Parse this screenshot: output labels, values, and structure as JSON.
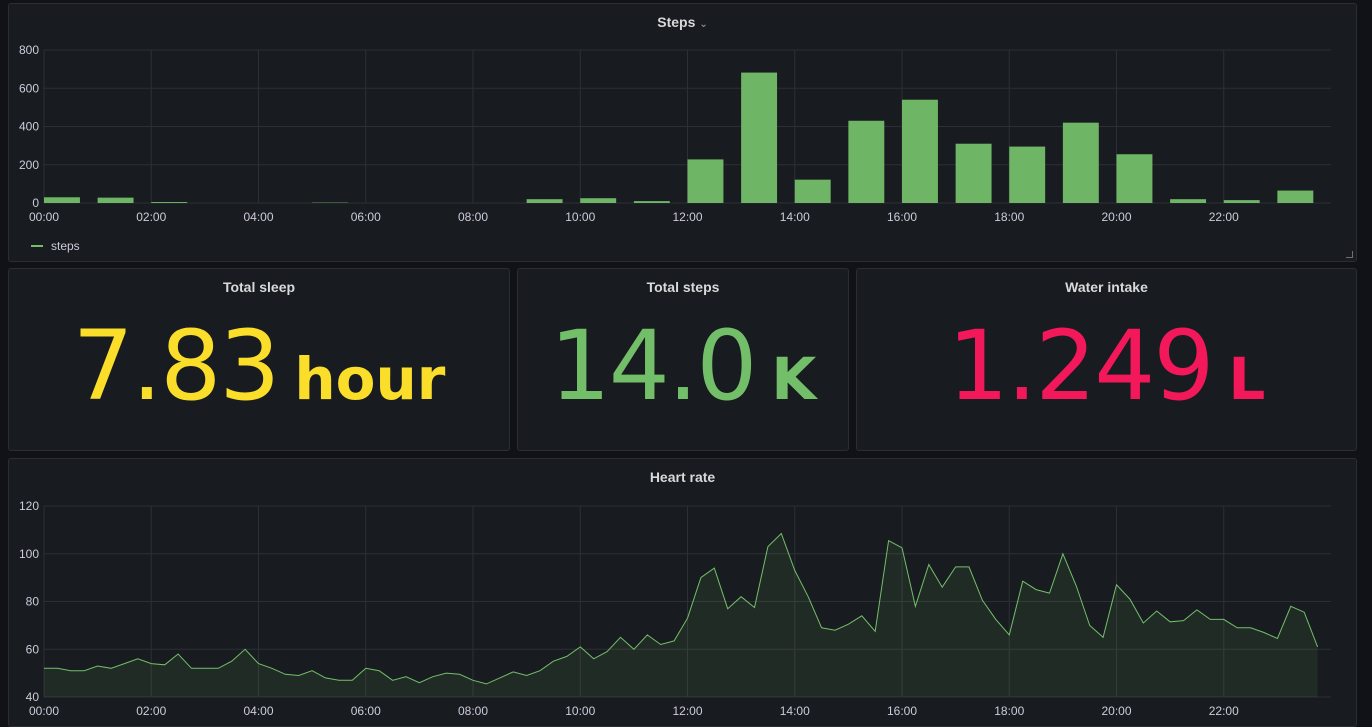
{
  "colors": {
    "background": "#111217",
    "panel": "#181b1f",
    "grid": "#2c2f35",
    "steps": "#73bf69",
    "sleep": "#fade2a",
    "water": "#f2185a"
  },
  "panels": {
    "steps": {
      "title": "Steps",
      "menu_icon": "chevron-down-icon",
      "legend": "steps"
    },
    "sleep": {
      "title": "Total sleep",
      "value": "7.83",
      "unit": "hour"
    },
    "total_steps": {
      "title": "Total steps",
      "value": "14.0",
      "unit": "K"
    },
    "water": {
      "title": "Water intake",
      "value": "1.249",
      "unit": "L"
    },
    "heart": {
      "title": "Heart rate"
    }
  },
  "chart_data": [
    {
      "type": "bar",
      "title": "Steps",
      "x_ticks": [
        "00:00",
        "02:00",
        "04:00",
        "06:00",
        "08:00",
        "10:00",
        "12:00",
        "14:00",
        "16:00",
        "18:00",
        "20:00",
        "22:00"
      ],
      "y_ticks": [
        "0",
        "200",
        "400",
        "600",
        "800"
      ],
      "ylim": [
        0,
        800
      ],
      "grid": true,
      "legend": "bottom-left",
      "series": [
        {
          "name": "steps",
          "x": [
            0,
            1,
            2,
            3,
            4,
            5,
            6,
            7,
            8,
            9,
            10,
            11,
            12,
            13,
            14,
            15,
            16,
            17,
            18,
            19,
            20,
            21,
            22,
            23
          ],
          "values": [
            30,
            28,
            5,
            0,
            0,
            2,
            0,
            0,
            0,
            20,
            25,
            10,
            228,
            682,
            122,
            430,
            540,
            310,
            295,
            420,
            255,
            20,
            15,
            65
          ]
        }
      ]
    },
    {
      "type": "area",
      "title": "Heart rate",
      "x_ticks": [
        "00:00",
        "02:00",
        "04:00",
        "06:00",
        "08:00",
        "10:00",
        "12:00",
        "14:00",
        "16:00",
        "18:00",
        "20:00",
        "22:00"
      ],
      "y_ticks": [
        "40",
        "60",
        "80",
        "100",
        "120"
      ],
      "ylim": [
        40,
        120
      ],
      "grid": true,
      "series": [
        {
          "name": "",
          "x": [
            0,
            0.25,
            0.5,
            0.75,
            1,
            1.25,
            1.5,
            1.75,
            2,
            2.25,
            2.5,
            2.75,
            3,
            3.25,
            3.5,
            3.75,
            4,
            4.25,
            4.5,
            4.75,
            5,
            5.25,
            5.5,
            5.75,
            6,
            6.25,
            6.5,
            6.75,
            7,
            7.25,
            7.5,
            7.75,
            8,
            8.25,
            8.5,
            8.75,
            9,
            9.25,
            9.5,
            9.75,
            10,
            10.25,
            10.5,
            10.75,
            11,
            11.25,
            11.5,
            11.75,
            12,
            12.25,
            12.5,
            12.75,
            13,
            13.25,
            13.5,
            13.75,
            14,
            14.25,
            14.5,
            14.75,
            15,
            15.25,
            15.5,
            15.75,
            16,
            16.25,
            16.5,
            16.75,
            17,
            17.25,
            17.5,
            17.75,
            18,
            18.25,
            18.5,
            18.75,
            19,
            19.25,
            19.5,
            19.75,
            20,
            20.25,
            20.5,
            20.75,
            21,
            21.25,
            21.5,
            21.75,
            22,
            22.25,
            22.5,
            22.75,
            23,
            23.25,
            23.5,
            23.75
          ],
          "values": [
            52,
            52,
            51,
            51,
            53,
            52,
            54,
            56,
            54,
            53.5,
            58,
            52,
            52,
            52,
            55,
            60,
            54,
            52,
            49.5,
            49,
            51,
            48,
            47,
            47,
            52,
            51,
            47,
            48.5,
            46,
            48.5,
            50,
            49.5,
            47,
            45.5,
            48,
            50.5,
            49,
            51,
            55,
            57,
            61,
            56,
            59,
            65,
            60,
            66,
            62,
            63.5,
            73,
            90,
            94,
            77,
            82,
            77.5,
            103,
            108.5,
            93,
            82,
            69,
            68,
            70.5,
            74,
            67.5,
            105.5,
            102.5,
            78,
            95.5,
            86,
            94.5,
            94.5,
            80.5,
            72.5,
            66,
            88.5,
            85,
            83.5,
            100,
            86.5,
            70,
            65,
            87,
            81,
            71,
            76,
            71.5,
            72,
            76.5,
            72.5,
            72.5,
            69,
            69,
            67,
            64.5,
            78,
            75.5,
            61
          ]
        }
      ]
    }
  ]
}
